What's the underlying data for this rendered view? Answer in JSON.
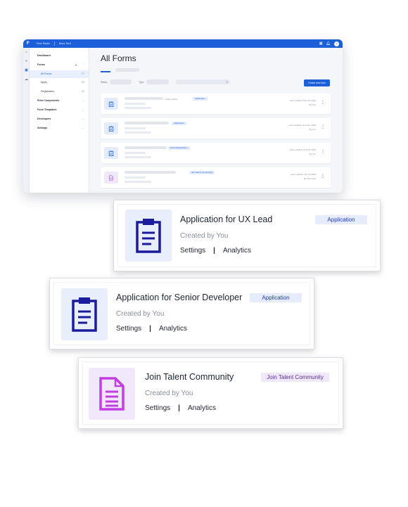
{
  "app": {
    "topbar": {
      "logo": "F",
      "product": "Flow Studio",
      "workspace": "Nova Tech"
    },
    "sidebar": {
      "items": [
        {
          "label": "Dashboard",
          "count": "",
          "plus": false,
          "chev": false
        },
        {
          "label": "Forms",
          "count": "⌃",
          "plus": true,
          "chev": true
        },
        {
          "label": "All Forms",
          "count": "97"
        },
        {
          "label": "Apply",
          "count": "34"
        },
        {
          "label": "Registration",
          "count": "52"
        },
        {
          "label": "Field Components",
          "count": "⌄"
        },
        {
          "label": "Form Templates",
          "count": "⌄"
        },
        {
          "label": "Developers",
          "count": "⌄"
        },
        {
          "label": "Settings",
          "count": "⌄"
        }
      ]
    },
    "main": {
      "title": "All Forms",
      "filters": {
        "status_label": "Status",
        "type_label": "Type"
      },
      "create_button": "Create new form",
      "rows": [
        {
          "draft": "4 days (draft)",
          "tag": "Application",
          "meta1": "Last modified: Dec 08, 2020",
          "meta2": "By You"
        },
        {
          "draft": "",
          "tag": "Application",
          "meta1": "Last modified: June 01, 2020",
          "meta2": "By You"
        },
        {
          "draft": "",
          "tag": "Event Registration",
          "meta1": "Last modified: Feb 08, 2020",
          "meta2": "By You"
        },
        {
          "draft": "",
          "tag": "Join Talent Community",
          "meta1": "Last modified: Jan 10 2020",
          "meta2": "By John Doe"
        }
      ]
    }
  },
  "cards": [
    {
      "title": "Application for UX Lead",
      "created_by": "Created by You",
      "settings": "Settings",
      "separator": "|",
      "analytics": "Analytics",
      "tag": "Application",
      "icon": "clipboard-icon"
    },
    {
      "title": "Application for Senior Developer",
      "created_by": "Created by You",
      "settings": "Settings",
      "separator": "|",
      "analytics": "Analytics",
      "tag": "Application",
      "icon": "clipboard-icon"
    },
    {
      "title": "Join Talent Community",
      "created_by": "Created by You",
      "settings": "Settings",
      "separator": "|",
      "analytics": "Analytics",
      "tag": "Join Talent Community",
      "icon": "document-icon"
    }
  ],
  "colors": {
    "brand": "#1d5fd8",
    "navy_icon": "#1b1b9e",
    "purple_icon": "#c23ee0",
    "tag_blue_bg": "#e6ecfb",
    "tag_purple_bg": "#efe8fa"
  }
}
